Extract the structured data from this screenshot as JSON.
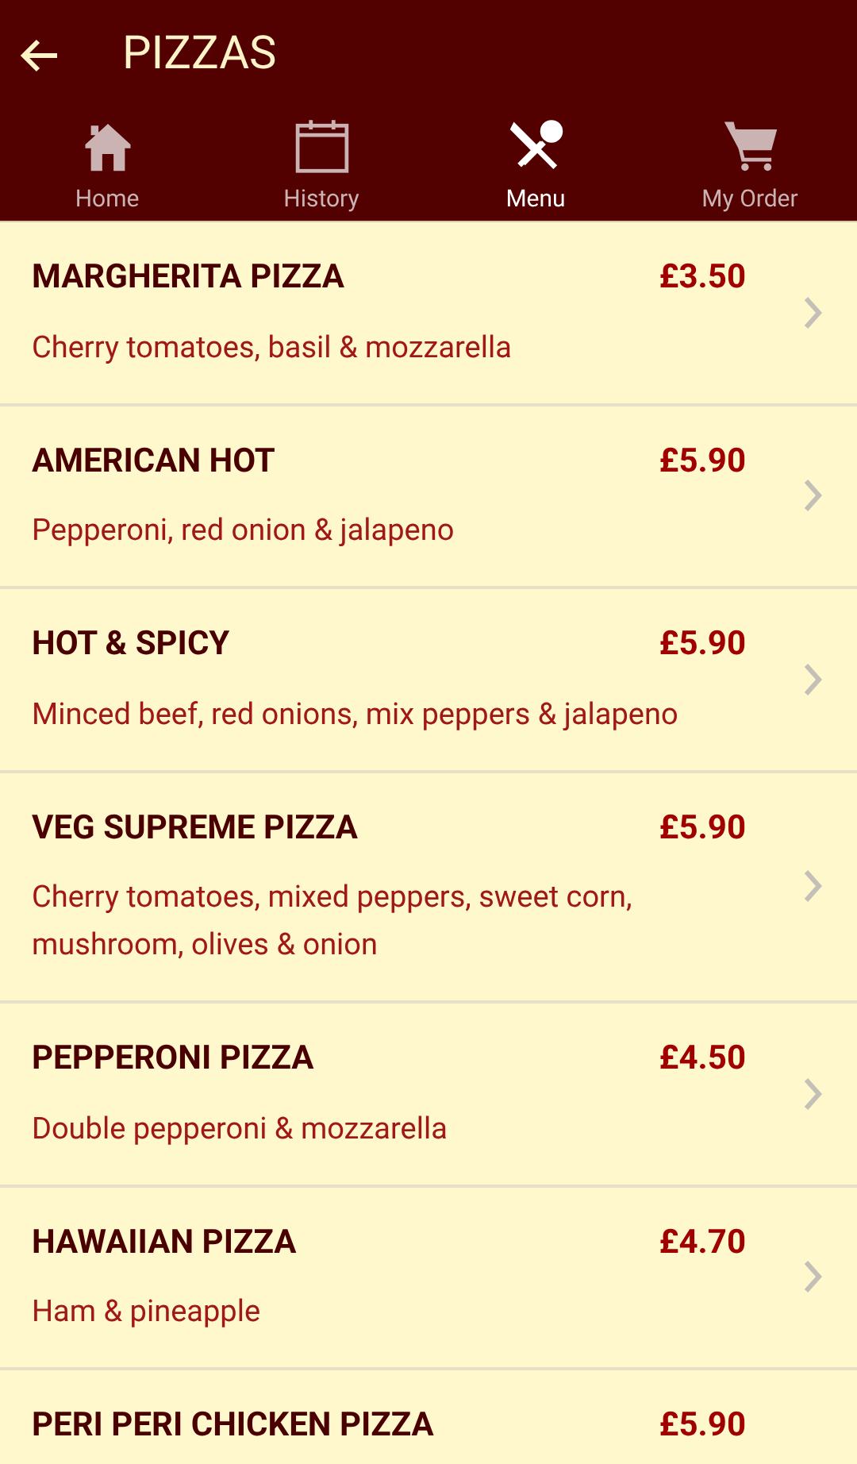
{
  "header": {
    "title": "PIZZAS"
  },
  "tabs": [
    {
      "label": "Home",
      "kind": "home",
      "selected": false
    },
    {
      "label": "History",
      "kind": "calendar",
      "selected": false
    },
    {
      "label": "Menu",
      "kind": "cutlery",
      "selected": true
    },
    {
      "label": "My Order",
      "kind": "cart",
      "selected": false
    }
  ],
  "items": [
    {
      "name": "MARGHERITA PIZZA",
      "price": "£3.50",
      "description": "Cherry tomatoes, basil & mozzarella"
    },
    {
      "name": "AMERICAN HOT",
      "price": "£5.90",
      "description": "Pepperoni, red onion & jalapeno"
    },
    {
      "name": "HOT & SPICY",
      "price": "£5.90",
      "description": "Minced beef, red onions, mix peppers & jalapeno"
    },
    {
      "name": "VEG SUPREME PIZZA",
      "price": "£5.90",
      "description": "Cherry tomatoes, mixed peppers, sweet corn, mushroom, olives & onion"
    },
    {
      "name": "PEPPERONI PIZZA",
      "price": "£4.50",
      "description": "Double pepperoni & mozzarella"
    },
    {
      "name": "HAWAIIAN PIZZA",
      "price": "£4.70",
      "description": "Ham & pineapple"
    },
    {
      "name": "PERI PERI CHICKEN PIZZA",
      "price": "£5.90"
    }
  ]
}
